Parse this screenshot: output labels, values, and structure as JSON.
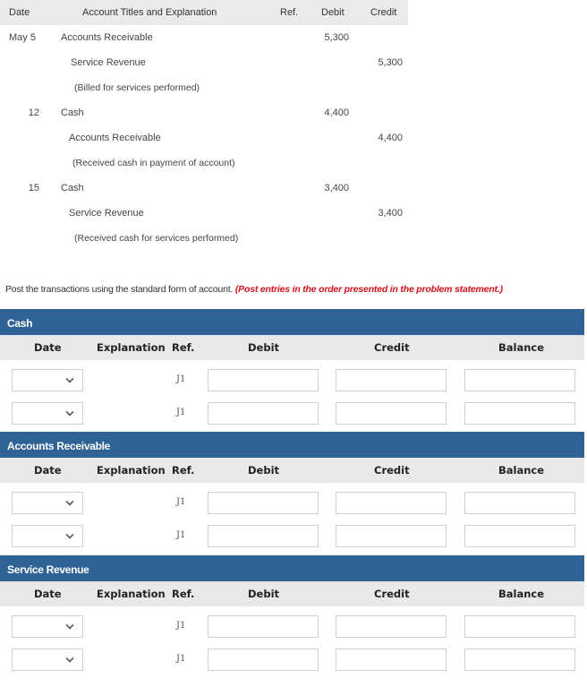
{
  "journal": {
    "headers": {
      "date": "Date",
      "account": "Account Titles and Explanation",
      "ref": "Ref.",
      "debit": "Debit",
      "credit": "Credit"
    },
    "rows": [
      {
        "date": "May 5",
        "account": "Accounts Receivable",
        "debit": "5,300",
        "credit": ""
      },
      {
        "date": "",
        "account": "Service Revenue",
        "debit": "",
        "credit": "5,300"
      },
      {
        "date": "",
        "account": "(Billed for services performed)",
        "debit": "",
        "credit": ""
      },
      {
        "date": "12",
        "account": "Cash",
        "debit": "4,400",
        "credit": ""
      },
      {
        "date": "",
        "account": "Accounts Receivable",
        "debit": "",
        "credit": "4,400"
      },
      {
        "date": "",
        "account": "(Received cash in payment of account)",
        "debit": "",
        "credit": ""
      },
      {
        "date": "15",
        "account": "Cash",
        "debit": "3,400",
        "credit": ""
      },
      {
        "date": "",
        "account": "Service Revenue",
        "debit": "",
        "credit": "3,400"
      },
      {
        "date": "",
        "account": "(Received cash for services performed)",
        "debit": "",
        "credit": ""
      }
    ]
  },
  "instructions": {
    "text": "Post the transactions using the standard form of account. ",
    "note": "(Post entries in the order presented in the problem statement.)"
  },
  "ledger_headers": {
    "date": "Date",
    "explanation": "Explanation",
    "ref": "Ref.",
    "debit": "Debit",
    "credit": "Credit",
    "balance": "Balance"
  },
  "ledgers": [
    {
      "title": "Cash",
      "rows": [
        {
          "date": "",
          "ref": "J1",
          "debit": "",
          "credit": "",
          "balance": ""
        },
        {
          "date": "",
          "ref": "J1",
          "debit": "",
          "credit": "",
          "balance": ""
        }
      ]
    },
    {
      "title": "Accounts Receivable",
      "rows": [
        {
          "date": "",
          "ref": "J1",
          "debit": "",
          "credit": "",
          "balance": ""
        },
        {
          "date": "",
          "ref": "J1",
          "debit": "",
          "credit": "",
          "balance": ""
        }
      ]
    },
    {
      "title": "Service Revenue",
      "rows": [
        {
          "date": "",
          "ref": "J1",
          "debit": "",
          "credit": "",
          "balance": ""
        },
        {
          "date": "",
          "ref": "J1",
          "debit": "",
          "credit": "",
          "balance": ""
        }
      ]
    }
  ],
  "colors": {
    "panel_header": "#2f6395",
    "column_header": "#e9e9e9",
    "note": "#d0121b"
  }
}
